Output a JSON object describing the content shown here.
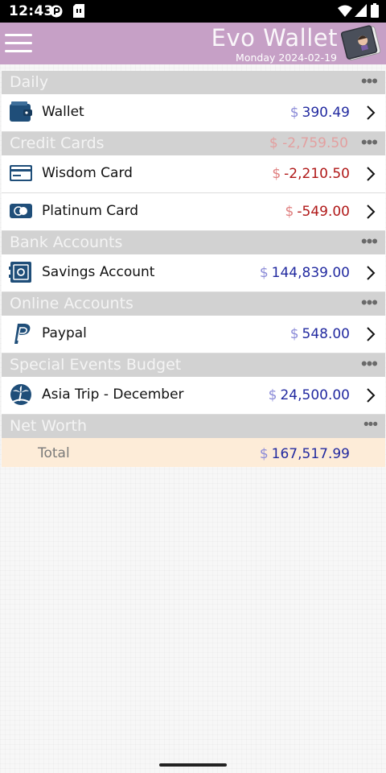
{
  "status_bar": {
    "time": "12:43",
    "icons": [
      "data-saver-icon",
      "sim-card-icon",
      "wifi-icon",
      "signal-icon",
      "battery-icon"
    ]
  },
  "header": {
    "title": "Evo  Wallet",
    "date": "Monday 2024-02-19",
    "menu_icon": "hamburger-menu-icon",
    "logo_icon": "wallet-book-icon",
    "background": "#c6a0c6"
  },
  "currency_symbol": "$",
  "sections": {
    "daily": {
      "name": "Daily",
      "total": "",
      "accounts": [
        {
          "name": "Wallet",
          "icon": "wallet-icon",
          "amount": "390.49",
          "negative": false
        }
      ]
    },
    "credit_cards": {
      "name": "Credit Cards",
      "total": "-2,759.50",
      "accounts": [
        {
          "name": "Wisdom Card",
          "icon": "credit-card-icon",
          "amount": "-2,210.50",
          "negative": true
        },
        {
          "name": "Platinum Card",
          "icon": "card-chip-icon",
          "amount": "-549.00",
          "negative": true
        }
      ]
    },
    "bank_accounts": {
      "name": "Bank Accounts",
      "total": "",
      "accounts": [
        {
          "name": "Savings Account",
          "icon": "safe-icon",
          "amount": "144,839.00",
          "negative": false
        }
      ]
    },
    "online_accounts": {
      "name": "Online Accounts",
      "total": "",
      "accounts": [
        {
          "name": "Paypal",
          "icon": "paypal-icon",
          "amount": "548.00",
          "negative": false
        }
      ]
    },
    "special_events": {
      "name": "Special Events Budget",
      "total": "",
      "accounts": [
        {
          "name": "Asia Trip - December",
          "icon": "island-icon",
          "amount": "24,500.00",
          "negative": false
        }
      ]
    },
    "net_worth": {
      "name": "Net Worth",
      "total_label": "Total",
      "total_amount": "167,517.99"
    }
  },
  "more_glyph": "•••",
  "colors": {
    "positive_amount": "#222aa0",
    "negative_amount": "#b01818",
    "section_header_bg": "#d2d2d2",
    "total_row_bg": "#fdecd8",
    "icon_blue": "#1f4e79"
  }
}
